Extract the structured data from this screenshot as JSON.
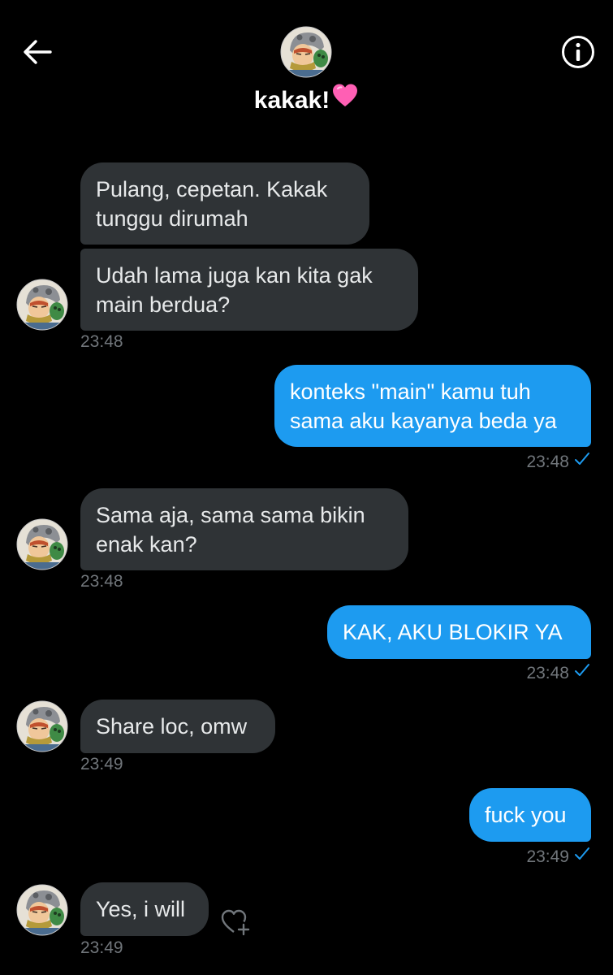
{
  "header": {
    "contact_name": "kakak!",
    "back_icon": "back-arrow-icon",
    "info_icon": "info-circle-icon",
    "name_emoji": "pink-heart-icon"
  },
  "colors": {
    "background": "#000000",
    "incoming_bubble": "#2f3336",
    "outgoing_bubble": "#1d9bf0",
    "timestamp": "#71767b",
    "read_check": "#1d9bf0"
  },
  "messages": [
    {
      "direction": "in",
      "lines": [
        "Pulang, cepetan. Kakak",
        "tunggu dirumah"
      ]
    },
    {
      "direction": "in",
      "lines": [
        "Udah lama juga kan kita gak",
        "main berdua?"
      ],
      "time": "23:48"
    },
    {
      "direction": "out",
      "lines": [
        "konteks \"main\" kamu tuh",
        "sama aku kayanya beda ya"
      ],
      "time": "23:48"
    },
    {
      "direction": "in",
      "lines": [
        "Sama aja, sama sama bikin",
        "enak kan?"
      ],
      "time": "23:48"
    },
    {
      "direction": "out",
      "lines": [
        "KAK, AKU BLOKIR YA"
      ],
      "time": "23:48"
    },
    {
      "direction": "in",
      "lines": [
        "Share loc, omw"
      ],
      "time": "23:49"
    },
    {
      "direction": "out",
      "lines": [
        "fuck you"
      ],
      "time": "23:49"
    },
    {
      "direction": "in",
      "lines": [
        "Yes, i will"
      ],
      "time": "23:49"
    }
  ]
}
